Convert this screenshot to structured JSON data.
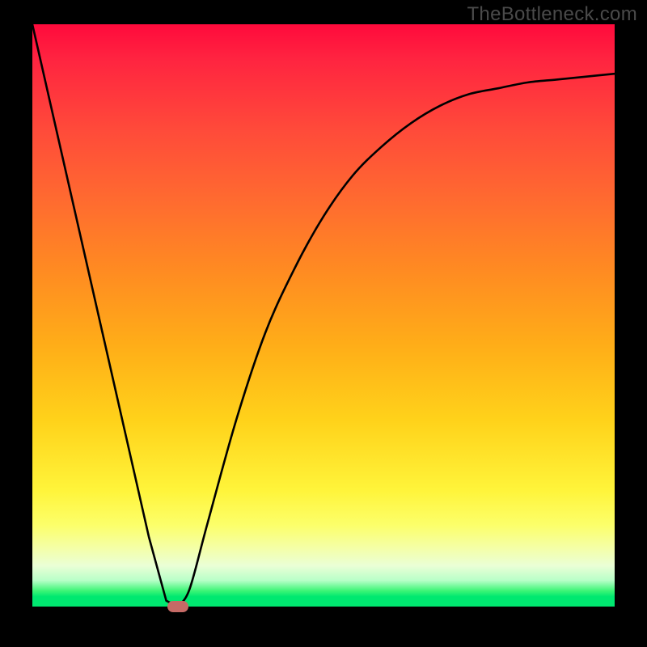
{
  "watermark": "TheBottleneck.com",
  "chart_data": {
    "type": "line",
    "title": "",
    "xlabel": "",
    "ylabel": "",
    "xlim": [
      0,
      100
    ],
    "ylim": [
      0,
      100
    ],
    "grid": false,
    "legend": false,
    "series": [
      {
        "name": "bottleneck-curve",
        "x": [
          0,
          5,
          10,
          15,
          20,
          23,
          25,
          27,
          30,
          35,
          40,
          45,
          50,
          55,
          60,
          65,
          70,
          75,
          80,
          85,
          90,
          95,
          100
        ],
        "y": [
          100,
          78,
          56,
          34,
          12,
          1,
          0,
          3,
          14,
          32,
          47,
          58,
          67,
          74,
          79,
          83,
          86,
          88,
          89,
          90,
          90.5,
          91,
          91.5
        ]
      }
    ],
    "marker": {
      "x": 25,
      "y": 0,
      "color": "#c66a66"
    },
    "gradient_stops": [
      {
        "offset": 0,
        "color": "#ff0a3c"
      },
      {
        "offset": 50,
        "color": "#ffad18"
      },
      {
        "offset": 85,
        "color": "#fff43a"
      },
      {
        "offset": 100,
        "color": "#00e870"
      }
    ]
  }
}
